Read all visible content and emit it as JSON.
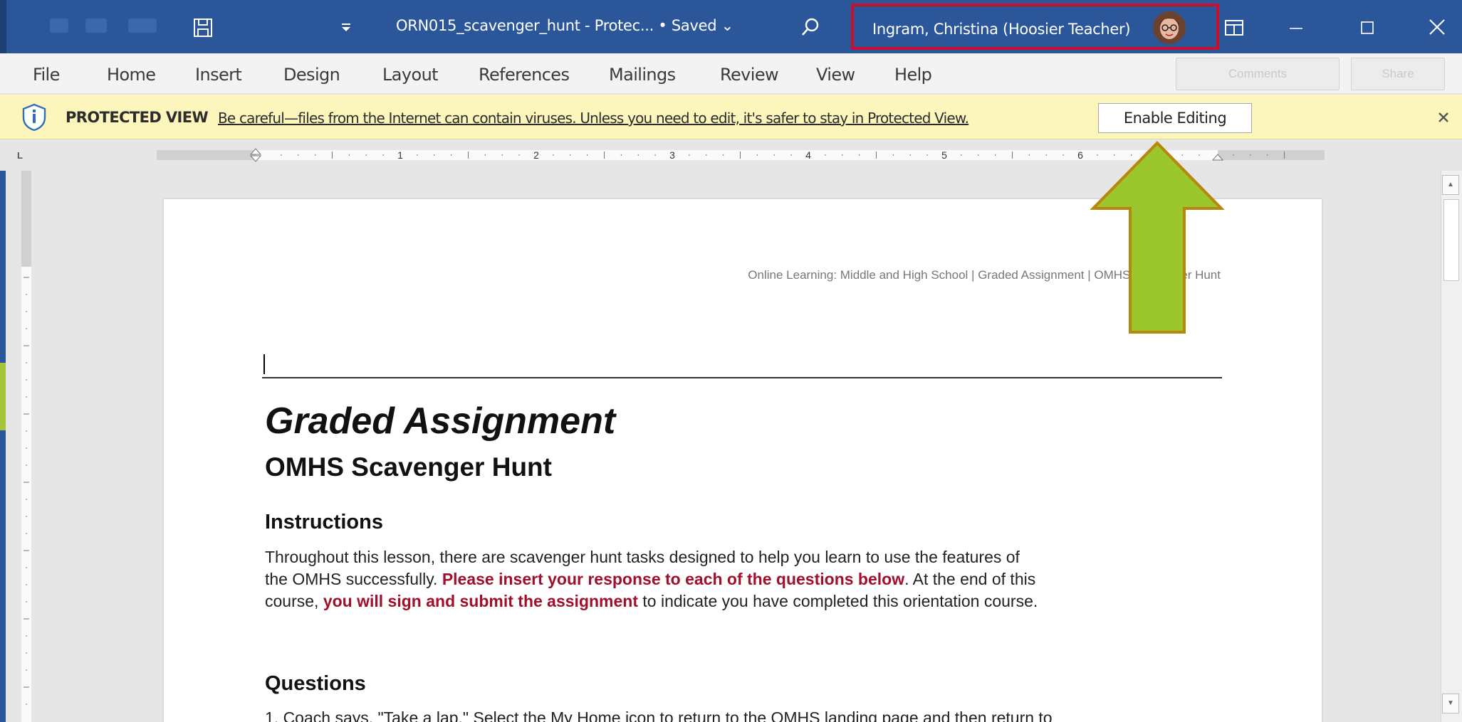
{
  "titlebar": {
    "doc_title": "ORN015_scavenger_hunt  -  Protec... • Saved ⌄",
    "user_name": "Ingram, Christina (Hoosier Teacher)"
  },
  "menu": {
    "items": [
      "File",
      "Home",
      "Insert",
      "Design",
      "Layout",
      "References",
      "Mailings",
      "Review",
      "View",
      "Help"
    ],
    "comments_label": "Comments",
    "share_label": "Share"
  },
  "protected_view": {
    "label": "PROTECTED VIEW",
    "message": "Be careful—files from the Internet can contain viruses. Unless you need to edit, it's safer to stay in Protected View.",
    "enable_button": "Enable Editing"
  },
  "ruler": {
    "numbers": [
      "1",
      "2",
      "3",
      "4",
      "5",
      "6"
    ],
    "tab_selector": "L"
  },
  "document": {
    "header": "Online Learning: Middle and High School | Graded Assignment | OMHS Scavenger Hunt",
    "title": "Graded Assignment",
    "subtitle": "OMHS Scavenger Hunt",
    "instructions_heading": "Instructions",
    "instr_line1": "Throughout this lesson, there are scavenger hunt tasks designed to help you learn to use the features of",
    "instr_line2_a": "the   OMHS successfully. ",
    "instr_line2_b": "Please insert your response to each of the questions below",
    "instr_line2_c": ". At the end of this",
    "instr_line3_a": "course, ",
    "instr_line3_b": "you will sign and submit the assignment",
    "instr_line3_c": " to indicate you have completed this orientation course.",
    "questions_heading": "Questions",
    "question1_partial": "1.    Coach says, \"Take a lap.\" Select the My Home icon to return to the OMHS landing page and then return to"
  },
  "colors": {
    "titlebar": "#2b579a",
    "protected_bar": "#fdf6bc",
    "highlight_box": "#c8102e",
    "arrow_fill": "#9cc62e",
    "arrow_stroke": "#b8860b",
    "emphasis_text": "#a0102a"
  }
}
